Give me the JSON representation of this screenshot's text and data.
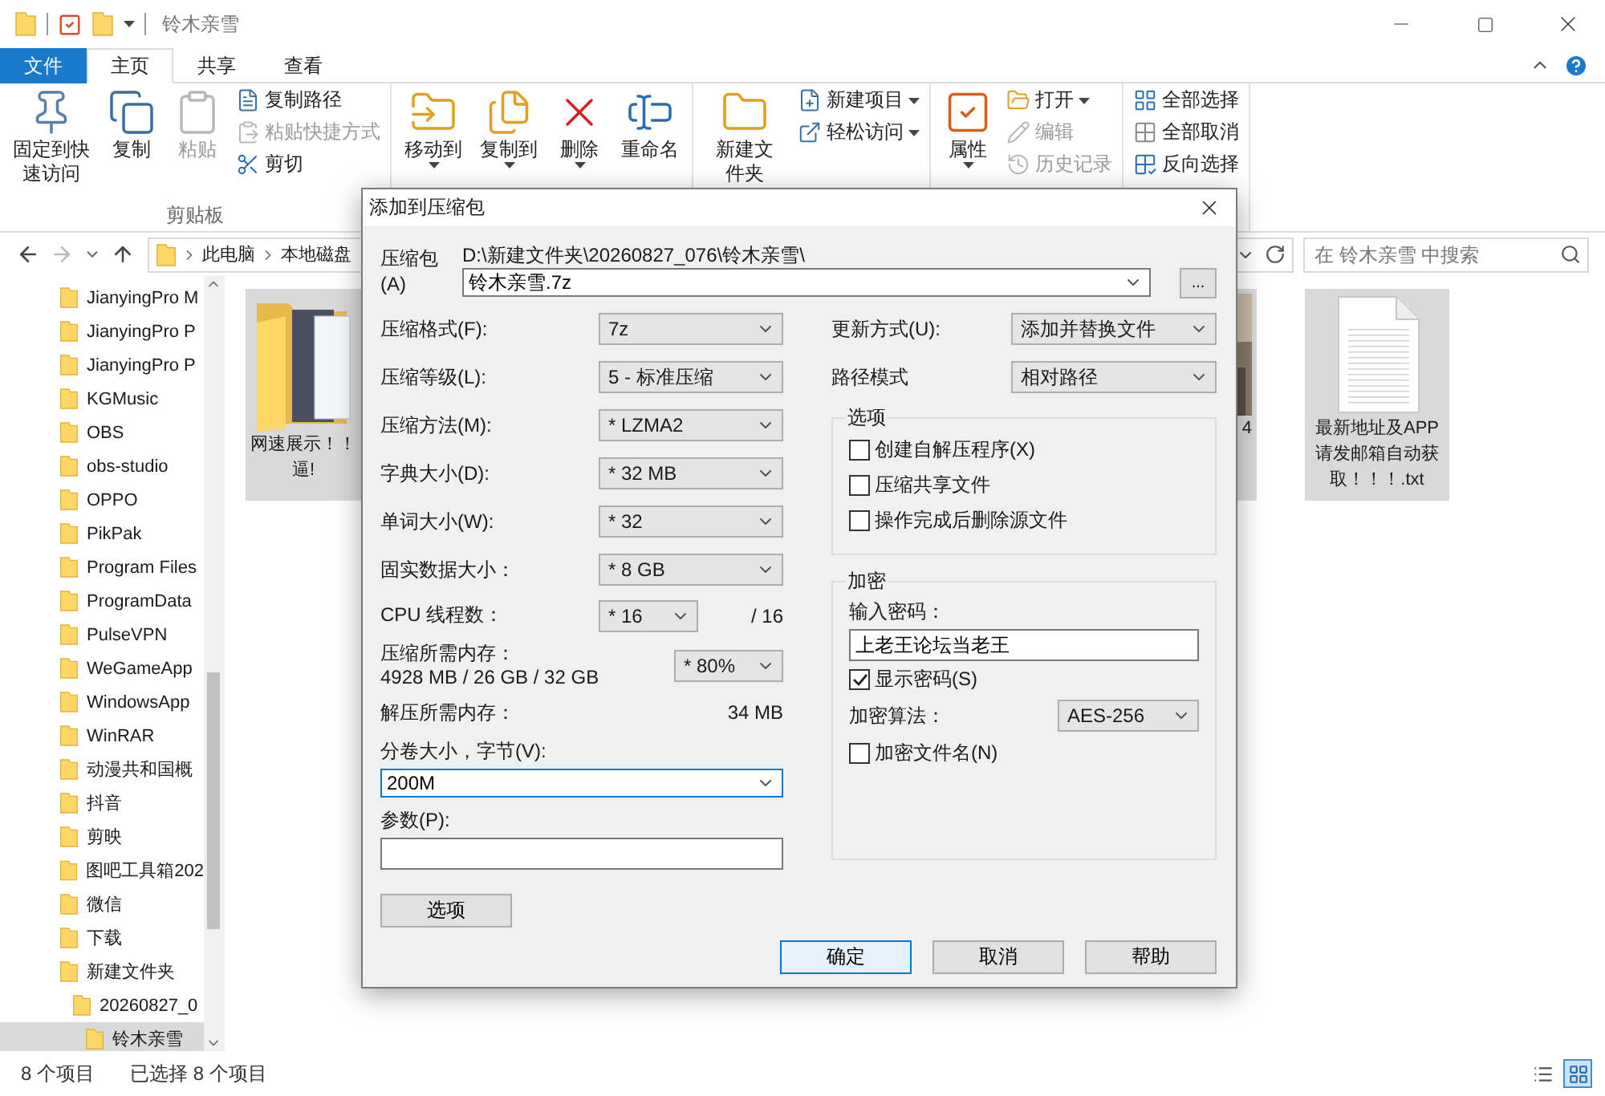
{
  "window": {
    "title": "铃木亲雪"
  },
  "ribbon_tabs": [
    {
      "label": "文件",
      "kind": "file",
      "selected": false
    },
    {
      "label": "主页",
      "kind": "tab",
      "selected": true
    },
    {
      "label": "共享",
      "kind": "tab",
      "selected": false
    },
    {
      "label": "查看",
      "kind": "tab",
      "selected": false
    }
  ],
  "ribbon_groups": [
    {
      "label": "剪贴板",
      "buttons": [
        {
          "label": "固定到快速访问",
          "kind": "large",
          "dropdown": false,
          "disabled": false
        },
        {
          "label": "复制",
          "kind": "large",
          "dropdown": false,
          "disabled": false
        },
        {
          "label": "粘贴",
          "kind": "large",
          "dropdown": false,
          "disabled": true
        },
        {
          "label": "复制路径",
          "kind": "small",
          "dropdown": false,
          "disabled": false
        },
        {
          "label": "粘贴快捷方式",
          "kind": "small",
          "dropdown": false,
          "disabled": true
        },
        {
          "label": "剪切",
          "kind": "small",
          "dropdown": false,
          "disabled": false
        }
      ]
    },
    {
      "buttons": [
        {
          "label": "移动到",
          "kind": "large",
          "dropdown": true,
          "disabled": false
        },
        {
          "label": "复制到",
          "kind": "large",
          "dropdown": true,
          "disabled": false
        },
        {
          "label": "删除",
          "kind": "large",
          "dropdown": true,
          "disabled": false
        },
        {
          "label": "重命名",
          "kind": "large",
          "dropdown": false,
          "disabled": false
        }
      ]
    },
    {
      "buttons": [
        {
          "label": "新建文件夹",
          "kind": "large",
          "dropdown": false,
          "disabled": false
        },
        {
          "label": "新建项目",
          "kind": "small",
          "dropdown": true,
          "disabled": false
        },
        {
          "label": "轻松访问",
          "kind": "small",
          "dropdown": true,
          "disabled": false
        }
      ]
    },
    {
      "buttons": [
        {
          "label": "属性",
          "kind": "large",
          "dropdown": true,
          "disabled": false
        },
        {
          "label": "打开",
          "kind": "small",
          "dropdown": true,
          "disabled": false
        },
        {
          "label": "编辑",
          "kind": "small",
          "dropdown": false,
          "disabled": true
        },
        {
          "label": "历史记录",
          "kind": "small",
          "dropdown": false,
          "disabled": true
        }
      ]
    },
    {
      "buttons": [
        {
          "label": "全部选择",
          "kind": "small",
          "dropdown": false,
          "disabled": false
        },
        {
          "label": "全部取消",
          "kind": "small",
          "dropdown": false,
          "disabled": false
        },
        {
          "label": "反向选择",
          "kind": "small",
          "dropdown": false,
          "disabled": false
        }
      ]
    }
  ],
  "address": {
    "crumbs": [
      "此电脑",
      "本地磁盘"
    ]
  },
  "search": {
    "placeholder": "在 铃木亲雪 中搜索"
  },
  "sidebar": {
    "items": [
      {
        "label": "JianyingPro M",
        "selected": false
      },
      {
        "label": "JianyingPro P",
        "selected": false
      },
      {
        "label": "JianyingPro P",
        "selected": false
      },
      {
        "label": "KGMusic",
        "selected": false
      },
      {
        "label": "OBS",
        "selected": false
      },
      {
        "label": "obs-studio",
        "selected": false
      },
      {
        "label": "OPPO",
        "selected": false
      },
      {
        "label": "PikPak",
        "selected": false
      },
      {
        "label": "Program Files",
        "selected": false
      },
      {
        "label": "ProgramData",
        "selected": false
      },
      {
        "label": "PulseVPN",
        "selected": false
      },
      {
        "label": "WeGameApp",
        "selected": false
      },
      {
        "label": "WindowsApp",
        "selected": false
      },
      {
        "label": "WinRAR",
        "selected": false
      },
      {
        "label": "动漫共和国概",
        "selected": false
      },
      {
        "label": "抖音",
        "selected": false
      },
      {
        "label": "剪映",
        "selected": false
      },
      {
        "label": "图吧工具箱202",
        "selected": false
      },
      {
        "label": "微信",
        "selected": false
      },
      {
        "label": "下载",
        "selected": false
      },
      {
        "label": "新建文件夹",
        "selected": false,
        "children": [
          {
            "label": "20260827_0",
            "selected": false,
            "children": [
              {
                "label": "铃木亲雪",
                "selected": true
              }
            ]
          }
        ]
      }
    ]
  },
  "files": [
    {
      "kind": "folder",
      "lines": [
        "网速展示！！",
        "逼!"
      ],
      "selected": true
    },
    {
      "kind": "video",
      "lines": [
        "4"
      ],
      "selected": true
    },
    {
      "kind": "text",
      "lines": [
        "最新地址及APP",
        "请发邮箱自动获",
        "取！！！.txt"
      ],
      "selected": true
    }
  ],
  "status": {
    "count": "8 个项目",
    "selection": "已选择 8 个项目"
  },
  "view_modes": [
    {
      "selected": false
    },
    {
      "selected": true
    }
  ],
  "dialog": {
    "title": "添加到压缩包",
    "archive": {
      "label": "压缩包(A)",
      "path": "D:\\新建文件夹\\20260827_076\\铃木亲雪\\",
      "value": "铃木亲雪.7z",
      "browse": "..."
    },
    "settings": [
      {
        "kind": "select",
        "label": "压缩格式(F):",
        "value": "7z"
      },
      {
        "kind": "select",
        "label": "压缩等级(L):",
        "value": "5 - 标准压缩"
      },
      {
        "kind": "select",
        "label": "压缩方法(M):",
        "value": "* LZMA2"
      },
      {
        "kind": "select",
        "label": "字典大小(D):",
        "value": "* 32 MB"
      },
      {
        "kind": "select",
        "label": "单词大小(W):",
        "value": "* 32"
      },
      {
        "kind": "select",
        "label": "固实数据大小：",
        "value": "* 8 GB"
      },
      {
        "kind": "threads",
        "label": "CPU 线程数：",
        "value": "* 16",
        "total": "/ 16"
      },
      {
        "kind": "memory",
        "label": "压缩所需内存：",
        "detail": "4928 MB / 26 GB / 32 GB",
        "value": "* 80%"
      },
      {
        "kind": "readout",
        "label": "解压所需内存：",
        "value": "34 MB"
      }
    ],
    "volume": {
      "label": "分卷大小，字节(V):",
      "value": "200M",
      "focused": true
    },
    "parameters": {
      "label": "参数(P):"
    },
    "options_button": "选项",
    "update_mode": {
      "label": "更新方式(U):",
      "value": "添加并替换文件"
    },
    "path_mode": {
      "label": "路径模式",
      "value": "相对路径"
    },
    "options": {
      "title": "选项",
      "checkboxes": [
        {
          "label": "创建自解压程序(X)",
          "checked": false
        },
        {
          "label": "压缩共享文件",
          "checked": false
        },
        {
          "label": "操作完成后删除源文件",
          "checked": false
        }
      ]
    },
    "encryption": {
      "title": "加密",
      "password_label": "输入密码：",
      "password": "上老王论坛当老王",
      "show_password": {
        "label": "显示密码(S)",
        "checked": true
      },
      "method_label": "加密算法：",
      "method": "AES-256",
      "encrypt_names": {
        "label": "加密文件名(N)",
        "checked": false
      }
    },
    "buttons": [
      {
        "label": "确定",
        "default": true
      },
      {
        "label": "取消",
        "default": false
      },
      {
        "label": "帮助",
        "default": false
      }
    ]
  }
}
